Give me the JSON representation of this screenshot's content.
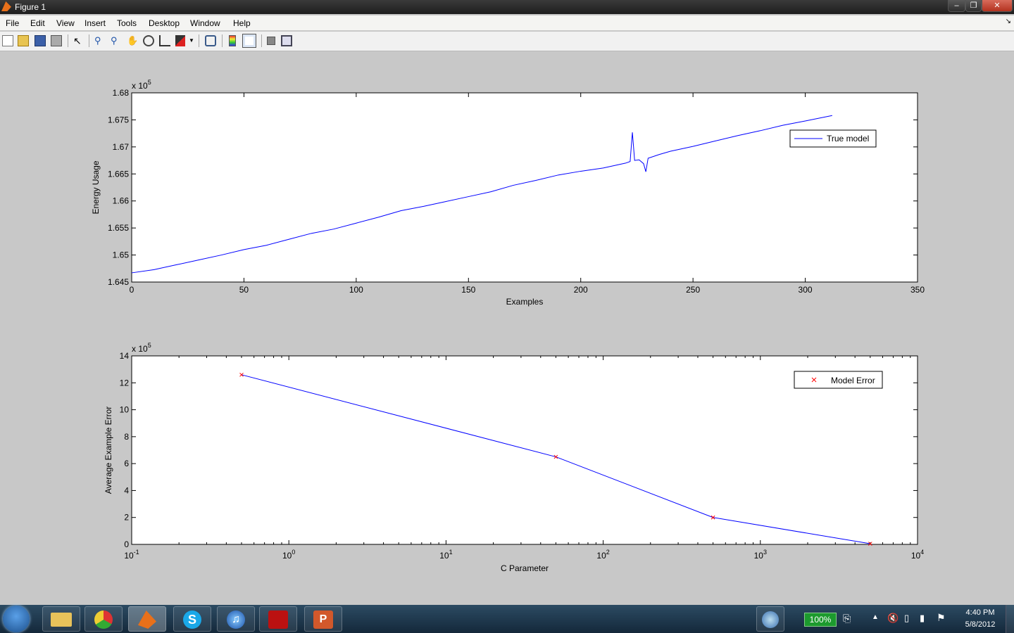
{
  "window": {
    "title": "Figure 1"
  },
  "menu": [
    "File",
    "Edit",
    "View",
    "Insert",
    "Tools",
    "Desktop",
    "Window",
    "Help"
  ],
  "toolbar_icons": [
    "new-figure-icon",
    "open-file-icon",
    "save-icon",
    "print-icon",
    "edit-plot-arrow-icon",
    "zoom-in-icon",
    "zoom-out-icon",
    "pan-hand-icon",
    "rotate-3d-icon",
    "data-cursor-icon",
    "brush-icon",
    "link-plot-icon",
    "insert-colorbar-icon",
    "insert-legend-icon",
    "hide-plot-tools-icon",
    "show-plot-tools-icon"
  ],
  "chart_data": [
    {
      "type": "line",
      "xlabel": "Examples",
      "ylabel": "Energy Usage",
      "xlim": [
        0,
        350
      ],
      "ylim": [
        164500,
        168000
      ],
      "xticks": [
        0,
        50,
        100,
        150,
        200,
        250,
        300,
        350
      ],
      "yticks": [
        "1.645",
        "1.65",
        "1.655",
        "1.66",
        "1.665",
        "1.67",
        "1.675",
        "1.68"
      ],
      "ytick_values": [
        164500,
        165000,
        165500,
        166000,
        166500,
        167000,
        167500,
        168000
      ],
      "yexponent": {
        "base": "x 10",
        "exp": "5"
      },
      "legend": {
        "position": "top-right",
        "entries": [
          "True model"
        ]
      },
      "grid": false,
      "color": "#0000ff",
      "series": [
        {
          "name": "True model",
          "x": [
            0,
            10,
            20,
            30,
            40,
            50,
            60,
            70,
            80,
            90,
            100,
            110,
            120,
            130,
            140,
            150,
            160,
            170,
            180,
            190,
            200,
            210,
            220,
            222,
            223,
            224,
            226,
            228,
            229,
            230,
            235,
            240,
            250,
            260,
            270,
            280,
            290,
            300,
            312
          ],
          "y": [
            164670,
            164730,
            164820,
            164910,
            165000,
            165100,
            165180,
            165290,
            165400,
            165480,
            165590,
            165700,
            165820,
            165900,
            165990,
            166080,
            166170,
            166290,
            166380,
            166480,
            166550,
            166610,
            166700,
            166730,
            167270,
            166750,
            166760,
            166690,
            166540,
            166790,
            166860,
            166920,
            167010,
            167110,
            167210,
            167300,
            167400,
            167480,
            167580
          ]
        }
      ]
    },
    {
      "type": "line",
      "xlabel": "C Parameter",
      "ylabel": "Average Example Error",
      "xscale": "log",
      "xlim": [
        0.1,
        10000
      ],
      "ylim": [
        0,
        1400000
      ],
      "xticks": [
        {
          "base": "10",
          "exp": "-1"
        },
        {
          "base": "10",
          "exp": "0"
        },
        {
          "base": "10",
          "exp": "1"
        },
        {
          "base": "10",
          "exp": "2"
        },
        {
          "base": "10",
          "exp": "3"
        },
        {
          "base": "10",
          "exp": "4"
        }
      ],
      "yticks": [
        "0",
        "2",
        "4",
        "6",
        "8",
        "10",
        "12",
        "14"
      ],
      "ytick_values": [
        0,
        200000,
        400000,
        600000,
        800000,
        1000000,
        1200000,
        1400000
      ],
      "yexponent": {
        "base": "x 10",
        "exp": "5"
      },
      "legend": {
        "position": "top-right",
        "entries": [
          "Model Error"
        ]
      },
      "grid": false,
      "line_color": "#0000ff",
      "marker_color": "#ff0000",
      "series": [
        {
          "name": "Model Error",
          "x": [
            0.5,
            50,
            500,
            5000
          ],
          "y": [
            1260000,
            650000,
            200000,
            5000
          ]
        }
      ]
    }
  ],
  "taskbar": {
    "apps": [
      "windows-explorer-icon",
      "chrome-icon",
      "matlab-icon",
      "skype-icon",
      "itunes-icon",
      "adobe-reader-icon",
      "powerpoint-icon"
    ],
    "battery": "100%",
    "time": "4:40 PM",
    "date": "5/8/2012"
  }
}
